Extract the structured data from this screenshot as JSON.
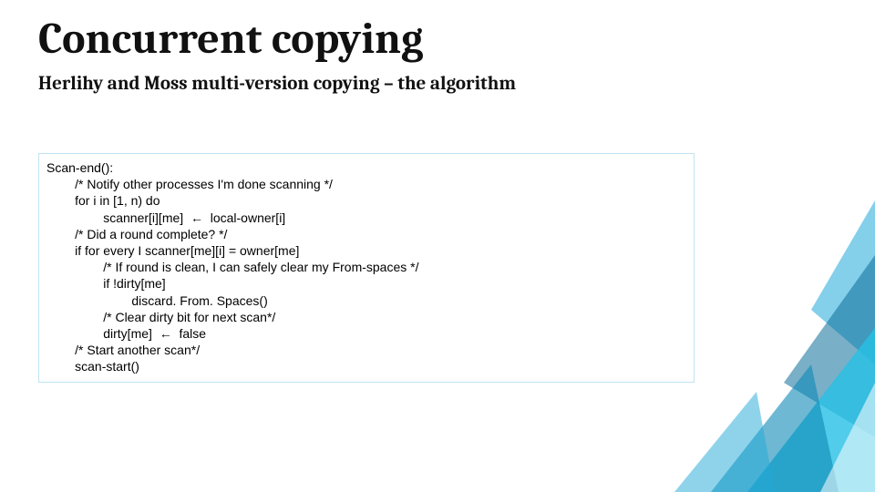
{
  "title": "Concurrent copying",
  "subtitle": "Herlihy and Moss multi-version copying – the algorithm",
  "code": "Scan-end():\n\t/* Notify other processes I'm done scanning */\n\tfor i in [1, n) do\n\t\tscanner[i][me]  ←  local-owner[i]\n\t/* Did a round complete? */\n\tif for every I scanner[me][i] = owner[me]\n\t\t/* If round is clean, I can safely clear my From-spaces */\n\t\tif !dirty[me]\n\t\t\tdiscard. From. Spaces()\n\t\t/* Clear dirty bit for next scan*/\n\t\tdirty[me]  ←  false\n\t/* Start another scan*/\n\tscan-start()"
}
